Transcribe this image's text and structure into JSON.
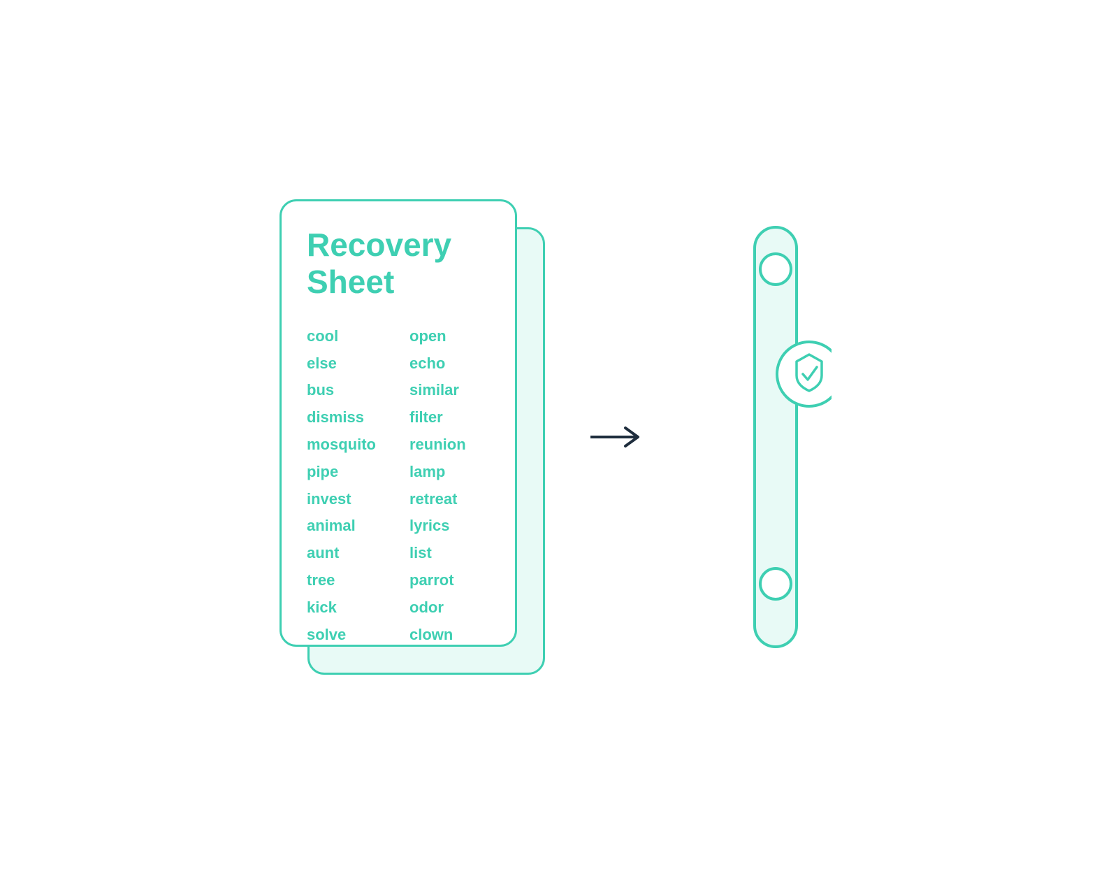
{
  "card": {
    "title_line1": "Recovery",
    "title_line2": "Sheet",
    "words_left": [
      "cool",
      "else",
      "bus",
      "dismiss",
      "mosquito",
      "pipe",
      "invest",
      "animal",
      "aunt",
      "tree",
      "kick",
      "solve"
    ],
    "words_right": [
      "open",
      "echo",
      "similar",
      "filter",
      "reunion",
      "lamp",
      "retreat",
      "lyrics",
      "list",
      "parrot",
      "odor",
      "clown"
    ]
  },
  "arrow": "→",
  "colors": {
    "teal": "#3ecfb2",
    "teal_light": "#e8faf6",
    "dark": "#1e2d3d"
  }
}
